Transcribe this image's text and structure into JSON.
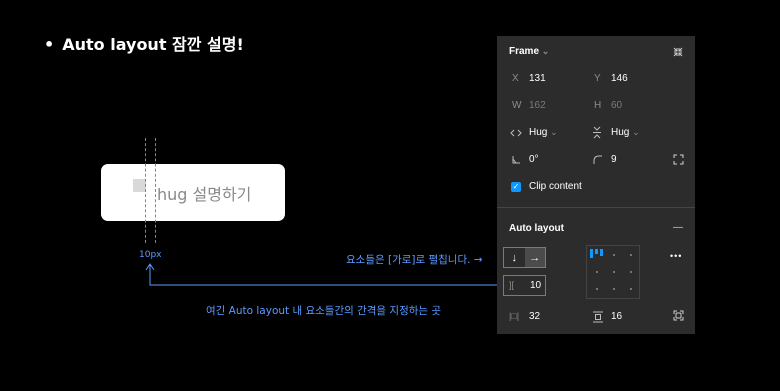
{
  "heading": {
    "bullet": "•",
    "text": "Auto layout 잠깐 설명!"
  },
  "demo": {
    "label": "hug 설명하기",
    "gap_label": "10px"
  },
  "annotations": {
    "direction_note": "요소들은 [가로]로 펼칩니다. →",
    "gap_note": "여긴 Auto layout 내 요소들간의 간격을 지정하는 곳"
  },
  "panel": {
    "frame": {
      "title": "Frame",
      "title_chevron": "⌄"
    },
    "position": {
      "x_label": "X",
      "x": "131",
      "y_label": "Y",
      "y": "146"
    },
    "size": {
      "w_label": "W",
      "w": "162",
      "h_label": "H",
      "h": "60"
    },
    "resizing": {
      "horizontal": "Hug",
      "vertical": "Hug",
      "chevron": "⌄"
    },
    "rotation": "0°",
    "corner_radius": "9",
    "clip_content": {
      "label": "Clip content",
      "checked": true
    },
    "auto_layout": {
      "title": "Auto layout",
      "remove_symbol": "—",
      "direction_down": "↓",
      "direction_right": "→",
      "direction_selected": "horizontal",
      "gap_icon": "][",
      "gap": "10",
      "padding_horizontal_icon": "|□|",
      "padding_horizontal": "32",
      "padding_vertical": "16",
      "more": "•••"
    }
  },
  "colors": {
    "accent": "#0d99ff",
    "annotation": "#5b9bff",
    "panel_bg": "#2c2c2c"
  }
}
